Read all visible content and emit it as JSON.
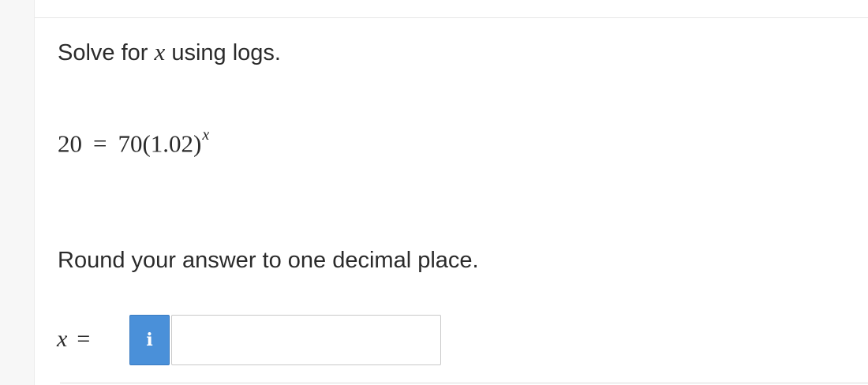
{
  "question": {
    "prompt_before": "Solve for ",
    "prompt_var": "x",
    "prompt_after": " using logs."
  },
  "equation": {
    "lhs": "20",
    "operator": "=",
    "rhs_base": "70(1.02)",
    "rhs_exponent": "x"
  },
  "instruction": "Round your answer to one decimal place.",
  "answer": {
    "label_var": "x",
    "label_eq": "=",
    "info_glyph": "i",
    "info_icon": "info-icon",
    "value": "",
    "accent_color": "#4a90d9"
  }
}
